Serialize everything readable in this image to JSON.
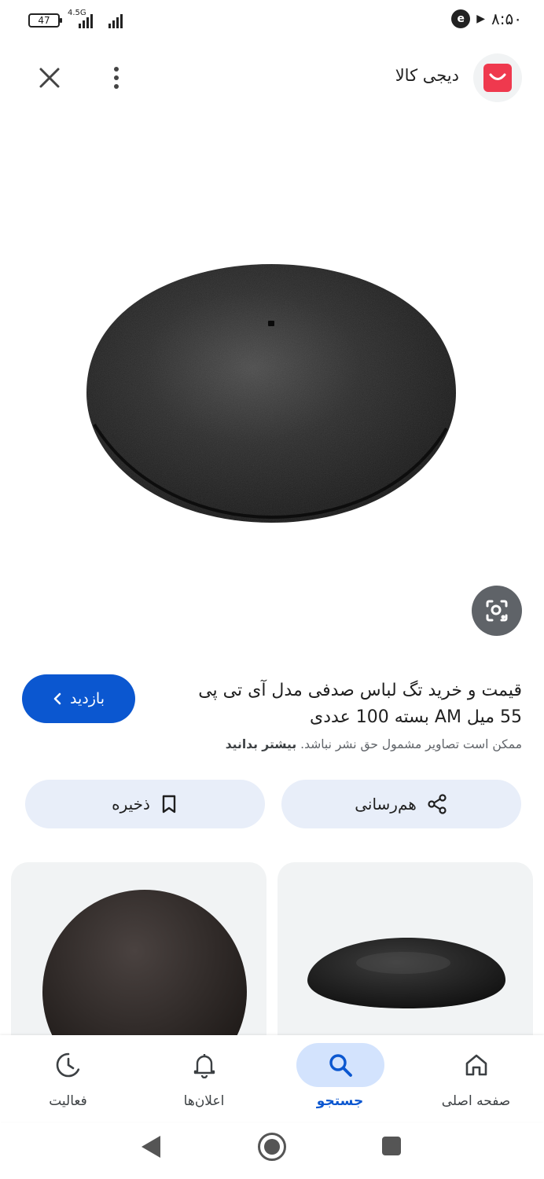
{
  "status_bar": {
    "battery": "47",
    "network": "4.5G",
    "time": "۸:۵۰"
  },
  "header": {
    "site_name": "دیجی کالا",
    "close_icon": "close-icon",
    "more_icon": "more-vert-icon",
    "logo_color": "#ef394e"
  },
  "result": {
    "title_line1": "قیمت و خرید تگ لباس صدفی مدل آی تی پی",
    "title_line2": "55 میل AM بسته 100 عددی",
    "visit_label": "بازدید",
    "copyright_text": "ممکن است تصاویر مشمول حق نشر نباشد.",
    "learn_more": "بیشتر بدانید",
    "share_label": "هم‌رسانی",
    "save_label": "ذخیره"
  },
  "bottom_nav": {
    "items": [
      {
        "label": "صفحه اصلی",
        "icon": "home-icon"
      },
      {
        "label": "جستجو",
        "icon": "search-icon",
        "active": true
      },
      {
        "label": "اعلان‌ها",
        "icon": "bell-icon"
      },
      {
        "label": "فعالیت",
        "icon": "activity-icon"
      }
    ]
  },
  "colors": {
    "accent": "#0b57d0",
    "accent_light": "#d3e3fd",
    "button_bg": "#e8eef9"
  }
}
